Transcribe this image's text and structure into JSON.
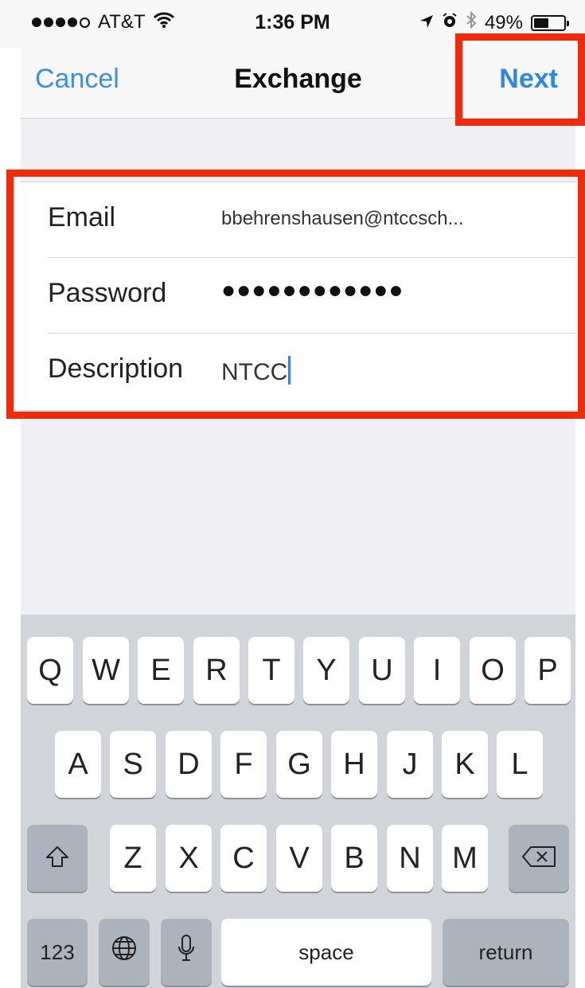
{
  "status_bar": {
    "carrier": "AT&T",
    "time": "1:36 PM",
    "battery_percent": "49%",
    "battery_level": 0.49,
    "icons": [
      "signal-dots",
      "wifi-icon",
      "location-icon",
      "alarm-icon",
      "bluetooth-icon",
      "battery-icon"
    ]
  },
  "nav": {
    "cancel_label": "Cancel",
    "title": "Exchange",
    "next_label": "Next"
  },
  "form": {
    "rows": [
      {
        "label": "Email",
        "value": "bbehrenshausen@ntccsch..."
      },
      {
        "label": "Password",
        "value": "●●●●●●●●●●●●"
      },
      {
        "label": "Description",
        "value": "NTCC"
      }
    ]
  },
  "keyboard": {
    "row1": [
      "Q",
      "W",
      "E",
      "R",
      "T",
      "Y",
      "U",
      "I",
      "O",
      "P"
    ],
    "row2": [
      "A",
      "S",
      "D",
      "F",
      "G",
      "H",
      "J",
      "K",
      "L"
    ],
    "row3": [
      "Z",
      "X",
      "C",
      "V",
      "B",
      "N",
      "M"
    ],
    "numbers_label": "123",
    "space_label": "space",
    "return_label": "return",
    "icons": [
      "shift-icon",
      "backspace-icon",
      "globe-icon",
      "microphone-icon"
    ]
  },
  "colors": {
    "accent_blue": "#2b88e6",
    "highlight_red": "#f22a0c",
    "caret_blue": "#3b7bf0"
  }
}
